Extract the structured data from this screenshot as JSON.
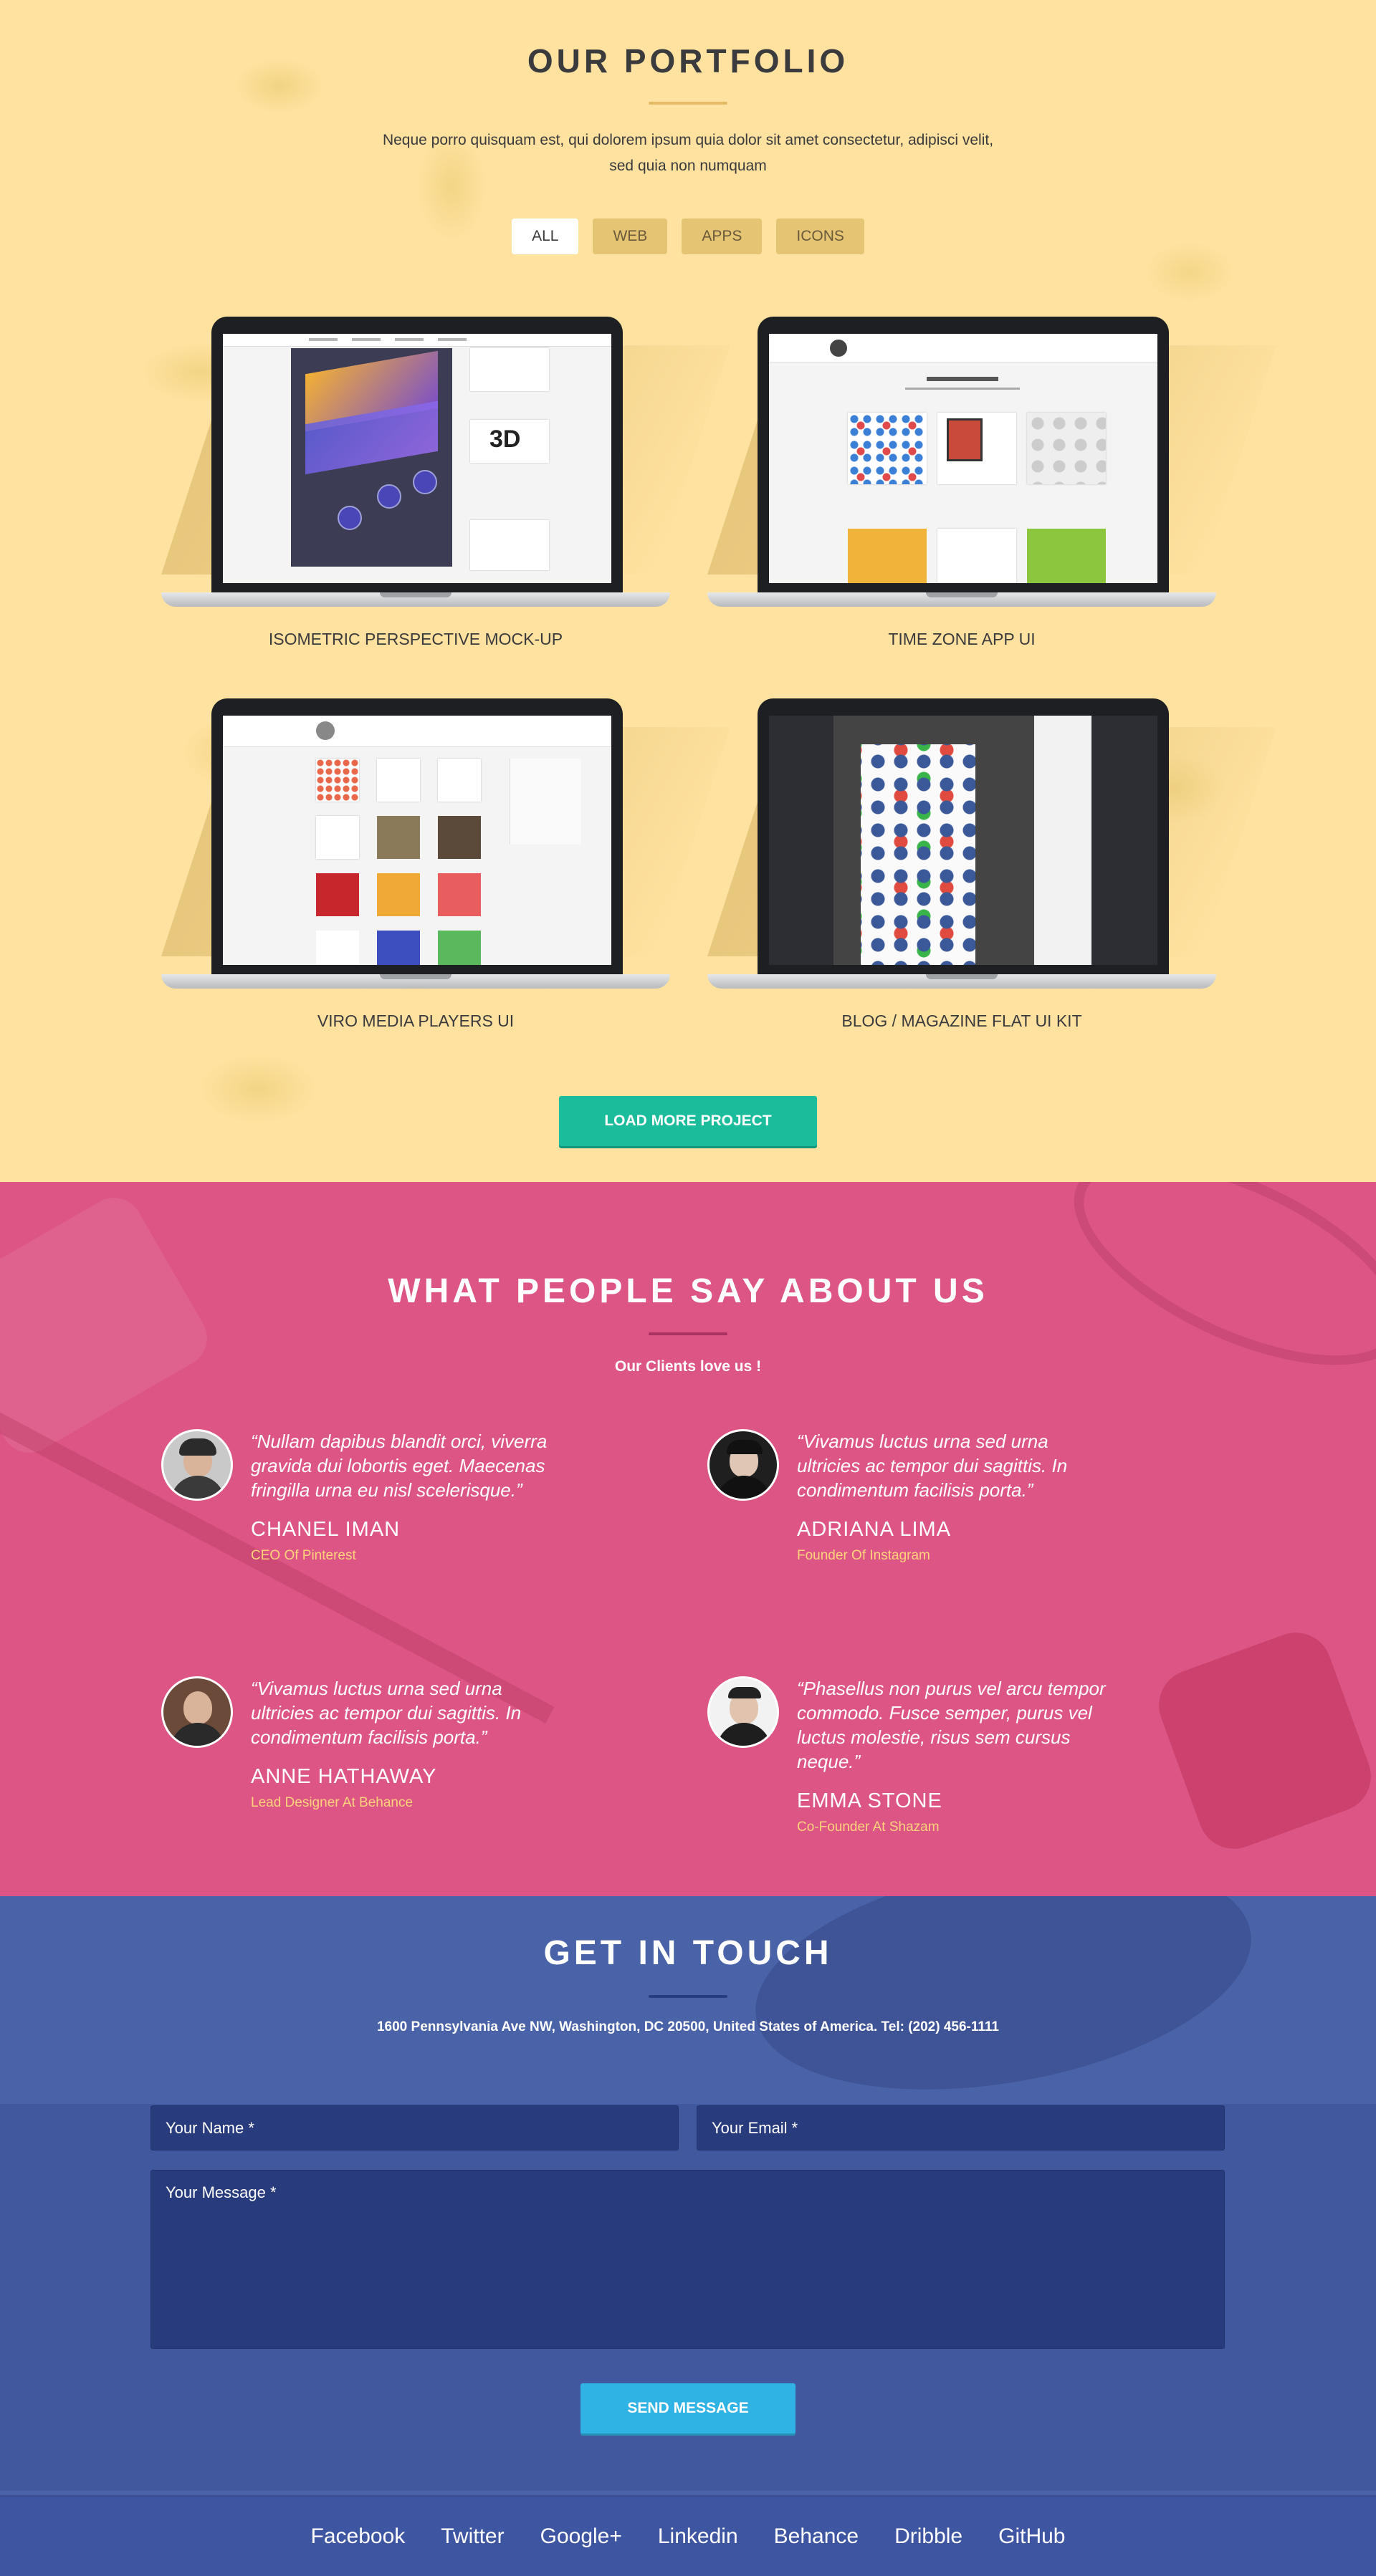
{
  "portfolio": {
    "title": "OUR PORTFOLIO",
    "intro_line1": "Neque porro quisquam est, qui dolorem ipsum quia dolor sit amet consectetur, adipisci velit,",
    "intro_line2": "sed quia non numquam",
    "filters": [
      "ALL",
      "WEB",
      "APPS",
      "ICONS"
    ],
    "active_filter": "ALL",
    "items": [
      {
        "caption": "ISOMETRIC PERSPECTIVE MOCK-UP"
      },
      {
        "caption": "TIME ZONE APP UI"
      },
      {
        "caption": "VIRO MEDIA PLAYERS UI"
      },
      {
        "caption": "BLOG / MAGAZINE FLAT UI KIT"
      }
    ],
    "load_more_label": "LOAD MORE PROJECT"
  },
  "testimonials": {
    "title": "WHAT PEOPLE SAY ABOUT US",
    "subtitle": "Our Clients love us !",
    "items": [
      {
        "quote": "“Nullam dapibus blandit orci, viverra gravida dui lobortis eget. Maecenas fringilla urna eu nisl scelerisque.”",
        "name": "CHANEL IMAN",
        "role": "CEO Of Pinterest"
      },
      {
        "quote": "“Vivamus luctus urna sed urna ultricies ac tempor dui sagittis. In condimentum facilisis porta.”",
        "name": "ADRIANA LIMA",
        "role": "Founder Of Instagram"
      },
      {
        "quote": "“Vivamus luctus urna sed urna ultricies ac tempor dui sagittis. In condimentum facilisis porta.”",
        "name": "ANNE HATHAWAY",
        "role": "Lead Designer At Behance"
      },
      {
        "quote": "“Phasellus non purus vel arcu tempor commodo. Fusce semper, purus vel luctus molestie, risus sem cursus neque.”",
        "name": "EMMA STONE",
        "role": "Co-Founder At Shazam"
      }
    ]
  },
  "contact": {
    "title": "GET IN TOUCH",
    "address": "1600 Pennsylvania Ave NW, Washington, DC 20500, United States of America. Tel: (202) 456-1111",
    "name_placeholder": "Your Name *",
    "email_placeholder": "Your Email *",
    "message_placeholder": "Your Message *",
    "send_label": "SEND MESSAGE"
  },
  "footer": {
    "links": [
      "Facebook",
      "Twitter",
      "Google+",
      "Linkedin",
      "Behance",
      "Dribble",
      "GitHub"
    ]
  },
  "colors": {
    "portfolio_bg": "#ffe29f",
    "testimonials_bg": "#dd5585",
    "contact_bg": "#4a62a8",
    "footer_bg": "#3e56a1",
    "load_more": "#1bbc9b",
    "send": "#2fb3e4",
    "role_text": "#ffd37b"
  }
}
